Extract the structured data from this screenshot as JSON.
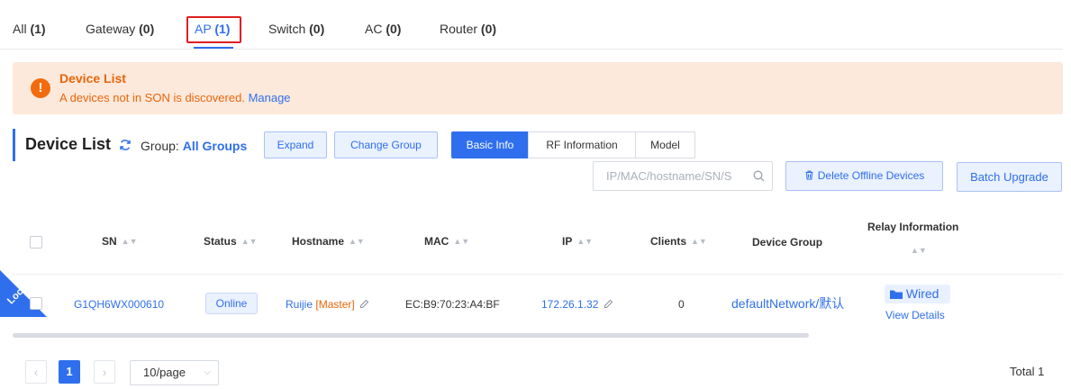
{
  "tabs": [
    {
      "label": "All",
      "count": "(1)"
    },
    {
      "label": "Gateway",
      "count": "(0)"
    },
    {
      "label": "AP",
      "count": "(1)"
    },
    {
      "label": "Switch",
      "count": "(0)"
    },
    {
      "label": "AC",
      "count": "(0)"
    },
    {
      "label": "Router",
      "count": "(0)"
    }
  ],
  "alert": {
    "icon": "!",
    "title": "Device List",
    "text": "A devices not in SON is discovered.",
    "link": "Manage"
  },
  "toolbar": {
    "title": "Device List",
    "group_label": "Group:",
    "group_value": "All Groups",
    "expand": "Expand",
    "change_group": "Change Group",
    "segments": [
      "Basic Info",
      "RF Information",
      "Model"
    ],
    "search_placeholder": "IP/MAC/hostname/SN/S",
    "delete_offline": "Delete Offline Devices",
    "batch_upgrade": "Batch Upgrade"
  },
  "table": {
    "headers": {
      "sn": "SN",
      "status": "Status",
      "hostname": "Hostname",
      "mac": "MAC",
      "ip": "IP",
      "clients": "Clients",
      "group": "Device Group",
      "relay": "Relay Information"
    },
    "rows": [
      {
        "corner": "Local",
        "sn": "G1QH6WX000610",
        "status": "Online",
        "hostname": "Ruijie",
        "role": "[Master]",
        "mac": "EC:B9:70:23:A4:BF",
        "ip": "172.26.1.32",
        "clients": "0",
        "group": "defaultNetwork/默认",
        "relay": "Wired",
        "relay_link": "View Details"
      }
    ]
  },
  "pagination": {
    "prev": "‹",
    "current": "1",
    "next": "›",
    "page_size": "10/page",
    "total": "Total 1"
  },
  "colors": {
    "accent": "#2f6fed",
    "warning": "#f26b0f",
    "alert_bg": "#fde9dc",
    "highlight": "#e02020"
  }
}
